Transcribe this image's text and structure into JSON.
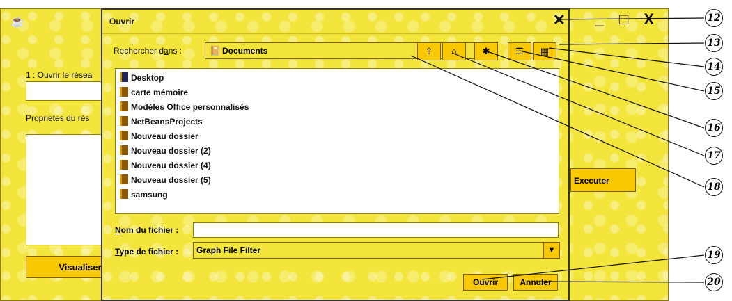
{
  "background_window": {
    "controls": "_ □ X",
    "label_open_network": "1 : Ouvrir le résea",
    "label_properties": "Proprietes du rés",
    "button_visualiser": "Visualiser le",
    "button_executer": "Executer"
  },
  "dialog": {
    "title": "Ouvrir",
    "close_glyph": "✕",
    "look_in_label": "Rechercher dans :",
    "look_in_value": "Documents",
    "files": [
      "Desktop",
      "carte mémoire",
      "Modèles Office personnalisés",
      "NetBeansProjects",
      "Nouveau dossier",
      "Nouveau dossier (2)",
      "Nouveau dossier (4)",
      "Nouveau dossier (5)",
      "samsung"
    ],
    "filename_label": "Nom du fichier :",
    "filename_value": "",
    "filetype_label": "Type de fichier :",
    "filetype_value": "Graph File Filter",
    "open_button": "Ouvrir",
    "cancel_button": "Annuler"
  },
  "callouts": [
    "12",
    "13",
    "14",
    "15",
    "16",
    "17",
    "18",
    "19",
    "20"
  ],
  "colors": {
    "theme_yellow": "#f3e53c",
    "button_yellow": "#f8c800"
  }
}
